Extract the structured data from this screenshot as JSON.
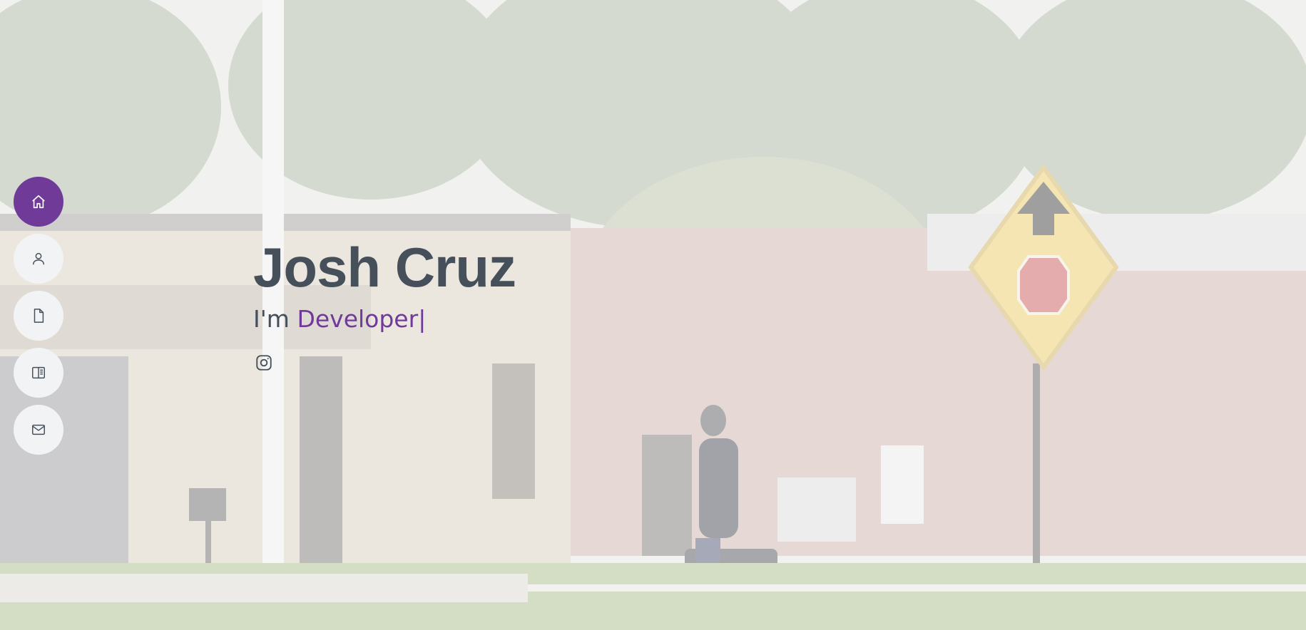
{
  "nav": {
    "items": [
      {
        "name": "home",
        "icon": "home-icon",
        "active": true
      },
      {
        "name": "about",
        "icon": "person-icon",
        "active": false
      },
      {
        "name": "resume",
        "icon": "file-icon",
        "active": false
      },
      {
        "name": "portfolio",
        "icon": "book-half-icon",
        "active": false
      },
      {
        "name": "contact",
        "icon": "envelope-icon",
        "active": false
      }
    ]
  },
  "hero": {
    "name": "Josh Cruz",
    "prefix": "I'm ",
    "typed": "Developer",
    "caret": "|",
    "social": [
      {
        "name": "instagram",
        "icon": "instagram-icon"
      }
    ]
  },
  "colors": {
    "accent": "#6f3a98",
    "text": "#45505b",
    "nav_bg": "#f2f3f5"
  }
}
